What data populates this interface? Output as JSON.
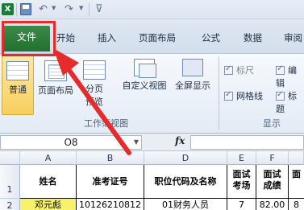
{
  "quick_access": {
    "app_icon": "excel-icon",
    "save_icon": "save-icon",
    "undo_icon": "undo-icon",
    "redo_icon": "redo-icon",
    "customize_icon": "customize-qat-icon"
  },
  "ribbon_tabs": {
    "file": "文件",
    "home": "开始",
    "insert": "插入",
    "page_layout": "页面布局",
    "formulas": "公式",
    "data": "数据",
    "review": "审阅"
  },
  "view_group": {
    "normal": "普通",
    "page_layout_line1": "页面布",
    "page_layout_line2": "局",
    "page_break_line1": "分页",
    "page_break_line2": "预览",
    "custom_views": "自定义视图",
    "full_screen": "全屏显示",
    "label": "工作簿视图"
  },
  "show_group": {
    "ruler": "标尺",
    "gridlines": "网格线",
    "formula_bar": "编辑",
    "headings": "标题",
    "label": "显示",
    "ruler_checked": true,
    "gridlines_checked": true,
    "formula_bar_checked": true,
    "headings_checked": true
  },
  "formula_bar": {
    "name_box": "O8",
    "fx": "fx",
    "value": ""
  },
  "grid": {
    "columns": [
      "A",
      "B",
      "C",
      "D",
      "E",
      "F"
    ],
    "rows": [
      "1",
      "2"
    ],
    "row1": {
      "A": "姓名",
      "B": "准考证号",
      "D": "职位代码及名称",
      "E": "面试考场",
      "F": "面试成绩",
      "G": "面"
    },
    "row2": {
      "A": "邓元彪",
      "B": "10126210812",
      "D": "01财务人员",
      "E": "7",
      "F": "82.00",
      "G": "8"
    }
  },
  "colors": {
    "file_tab": "#2e7d3c",
    "highlight": "#e52b2b",
    "selected_cell": "#f7f26a"
  }
}
